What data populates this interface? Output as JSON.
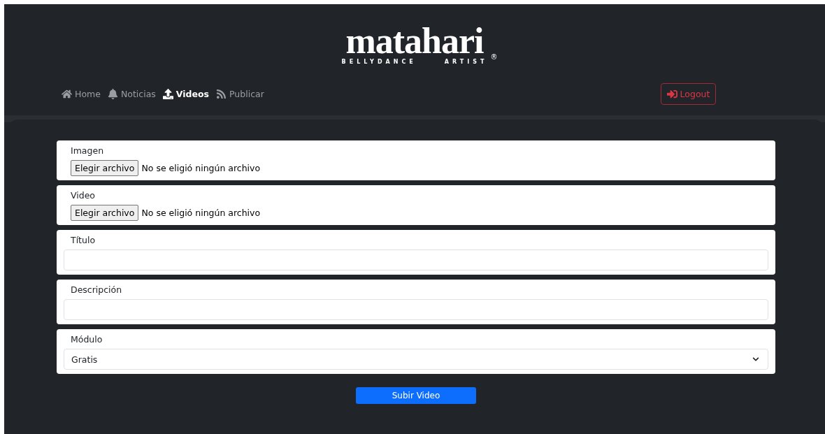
{
  "logo": {
    "name": "matahari",
    "registered": "®",
    "tagline_left": "BELLYDANCE",
    "tagline_right": "ARTIST"
  },
  "nav": [
    {
      "label": "Home",
      "selected": false
    },
    {
      "label": "Noticias",
      "selected": false
    },
    {
      "label": "Videos",
      "selected": true
    },
    {
      "label": "Publicar",
      "selected": false
    }
  ],
  "logout": {
    "label": "Logout"
  },
  "fields": [
    {
      "kind": "file",
      "label": "Imagen",
      "button": "Elegir archivo",
      "status": "No se eligió ningún archivo"
    },
    {
      "kind": "file",
      "label": "Video",
      "button": "Elegir archivo",
      "status": "No se eligió ningún archivo"
    },
    {
      "kind": "text",
      "label": "Título"
    },
    {
      "kind": "text",
      "label": "Descripción"
    },
    {
      "kind": "select",
      "label": "Módulo",
      "value": "Gratis"
    }
  ],
  "submit": {
    "label": "Subir Video"
  }
}
